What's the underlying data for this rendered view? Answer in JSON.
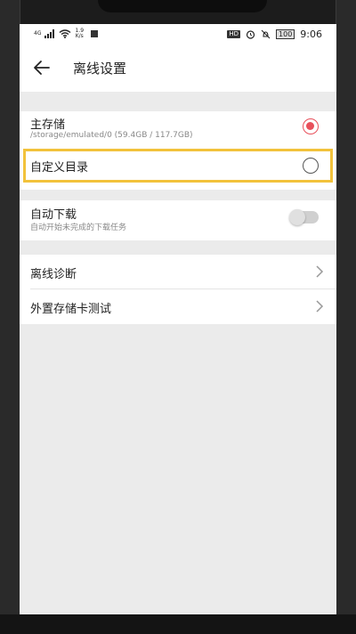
{
  "status_bar": {
    "network": "4G",
    "speed_top": "1.9",
    "speed_unit": "K/s",
    "hd_label": "HD",
    "battery": "100",
    "time": "9:06"
  },
  "app_bar": {
    "title": "离线设置",
    "back_icon": "arrow-left-icon"
  },
  "storage": {
    "main_label": "主存储",
    "main_path": "/storage/emulated/0 (59.4GB / 117.7GB)",
    "main_selected": true,
    "custom_label": "自定义目录",
    "custom_selected": false
  },
  "auto_download": {
    "label": "自动下载",
    "sub": "自动开始未完成的下载任务",
    "enabled": false
  },
  "tools": {
    "items": [
      {
        "label": "离线诊断"
      },
      {
        "label": "外置存储卡测试"
      }
    ]
  },
  "colors": {
    "accent": "#e8505b",
    "highlight": "#f2c23b"
  }
}
